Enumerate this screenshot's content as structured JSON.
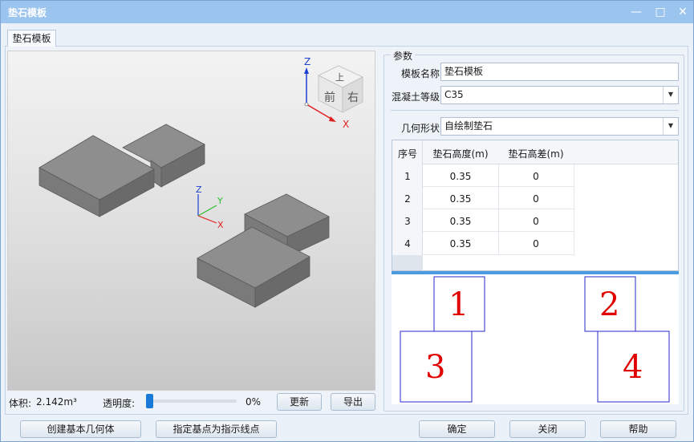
{
  "window": {
    "title": "垫石模板",
    "minimize_icon": "minimize-icon",
    "maximize_icon": "maximize-icon",
    "close_icon": "close-icon"
  },
  "tab": {
    "label": "垫石模板"
  },
  "viewport": {
    "navcube": {
      "top": "上",
      "front": "前",
      "right": "右"
    },
    "axes": {
      "x": "X",
      "y": "Y",
      "z": "Z"
    },
    "colors": {
      "x": "#e02020",
      "y": "#2fbf2f",
      "z": "#1f3fd0",
      "block": "#8a8a8a"
    }
  },
  "status": {
    "volume_label": "体积:",
    "volume_value": "2.142m³",
    "transparency_label": "透明度:",
    "transparency_value": "0%",
    "transparency_fraction": 0.0
  },
  "buttons": {
    "update": "更新",
    "export": "导出",
    "create_basic": "创建基本几何体",
    "set_base_point": "指定基点为指示线点",
    "ok": "确定",
    "close": "关闭",
    "help": "帮助"
  },
  "params": {
    "group_title": "参数",
    "template_name_label": "模板名称",
    "template_name_value": "垫石模板",
    "concrete_grade_label": "混凝土等级",
    "concrete_grade_value": "C35",
    "geometry_label": "几何形状",
    "geometry_value": "自绘制垫石"
  },
  "table": {
    "headers": [
      "序号",
      "垫石高度(m)",
      "垫石高差(m)"
    ],
    "rows": [
      [
        "1",
        "0.35",
        "0"
      ],
      [
        "2",
        "0.35",
        "0"
      ],
      [
        "3",
        "0.35",
        "0"
      ],
      [
        "4",
        "0.35",
        "0"
      ]
    ]
  },
  "preview": {
    "labels": [
      "1",
      "2",
      "3",
      "4"
    ],
    "label_color": "#e00000",
    "box_color": "#2a2acf"
  }
}
